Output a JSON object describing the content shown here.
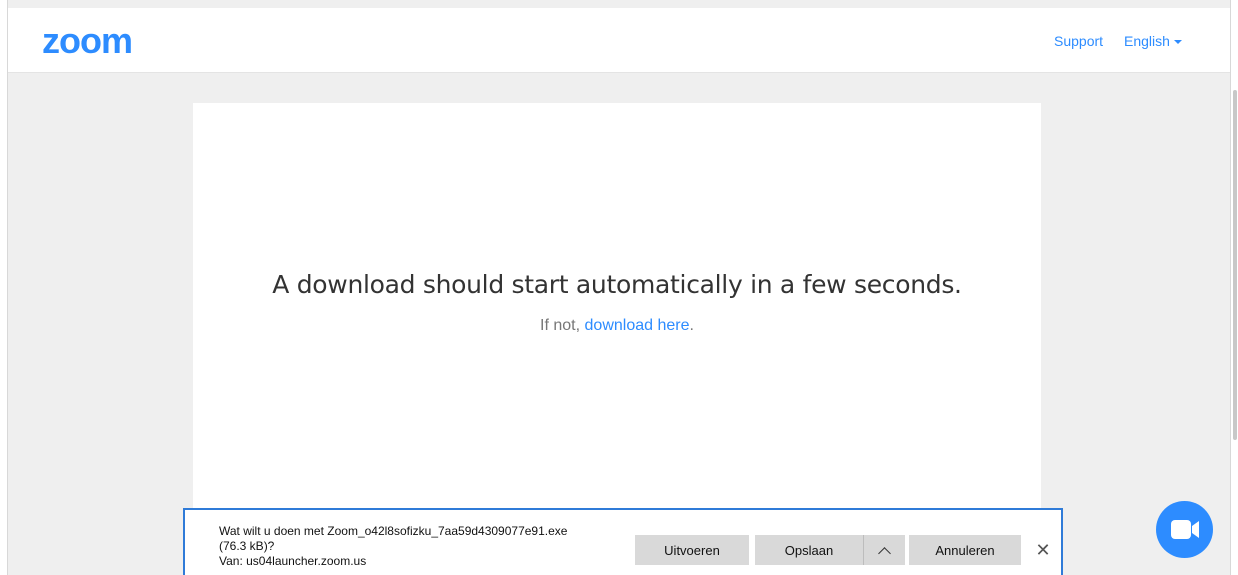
{
  "header": {
    "logo_text": "zoom",
    "support_label": "Support",
    "language_label": "English"
  },
  "main": {
    "headline": "A download should start automatically in a few seconds.",
    "subline_prefix": "If not, ",
    "download_link_label": "download here",
    "subline_suffix": "."
  },
  "download_bar": {
    "prompt_line1": "Wat wilt u doen met Zoom_o42l8sofizku_7aa59d4309077e91.exe",
    "prompt_line2": "(76.3 kB)?",
    "source_line": "Van: us04launcher.zoom.us",
    "run_label": "Uitvoeren",
    "save_label": "Opslaan",
    "cancel_label": "Annuleren",
    "close_glyph": "✕"
  },
  "colors": {
    "brand_blue": "#2d8cff",
    "bar_border": "#2f7bd8",
    "button_gray": "#d9d9d9"
  },
  "icons": {
    "fab": "video-camera-icon",
    "save_more": "chevron-up-icon",
    "close": "close-icon",
    "language": "caret-down-icon"
  }
}
